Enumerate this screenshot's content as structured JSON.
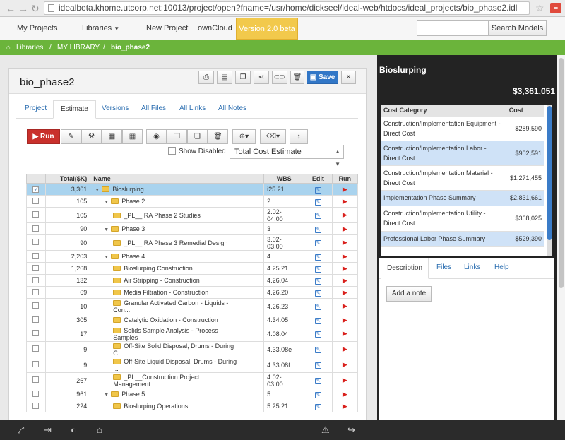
{
  "browser": {
    "url": "idealbeta.khome.utcorp.net:10013/project/open?fname=/usr/home/dickseel/ideal-web/htdocs/ideal_projects/bio_phase2.idl"
  },
  "topnav": {
    "my_projects": "My Projects",
    "libraries": "Libraries",
    "new_project": "New Project",
    "owncloud": "ownCloud",
    "version": "Version 2.0 beta",
    "search_placeholder": "",
    "search_button": "Search Models"
  },
  "breadcrumb": {
    "libraries": "Libraries",
    "my_library": "MY LIBRARY",
    "current": "bio_phase2"
  },
  "panel": {
    "title": "bio_phase2",
    "save": "Save",
    "close": "×",
    "tabs": [
      "Project",
      "Estimate",
      "Versions",
      "All Files",
      "All Links",
      "All Notes"
    ],
    "run": "Run",
    "show_disabled": "Show Disabled",
    "estimate_select": "Total Cost Estimate"
  },
  "grid": {
    "headers": [
      "",
      "Total($K)",
      "Name",
      "WBS",
      "Edit",
      "Run"
    ],
    "rows": [
      {
        "total": "3,361",
        "name": "Bioslurping",
        "wbs": "i25.21"
      },
      {
        "total": "105",
        "name": "Phase 2",
        "wbs": "2"
      },
      {
        "total": "105",
        "name": "_PL__IRA Phase 2 Studies",
        "wbs": "2.02-\n04.00"
      },
      {
        "total": "90",
        "name": "Phase 3",
        "wbs": "3"
      },
      {
        "total": "90",
        "name": "_PL__IRA Phase 3 Remedial Design",
        "wbs": "3.02-\n03.00"
      },
      {
        "total": "2,203",
        "name": "Phase 4",
        "wbs": "4"
      },
      {
        "total": "1,268",
        "name": "Bioslurping Construction",
        "wbs": "4.25.21"
      },
      {
        "total": "132",
        "name": "Air Stripping - Construction",
        "wbs": "4.26.04"
      },
      {
        "total": "69",
        "name": "Media Filtration - Construction",
        "wbs": "4.26.20"
      },
      {
        "total": "10",
        "name": "Granular Activated Carbon - Liquids -\nCon...",
        "wbs": "4.26.23"
      },
      {
        "total": "305",
        "name": "Catalytic Oxidation - Construction",
        "wbs": "4.34.05"
      },
      {
        "total": "17",
        "name": "Solids Sample Analysis - Process\nSamples",
        "wbs": "4.08.04"
      },
      {
        "total": "9",
        "name": "Off-Site Solid Disposal, Drums - During\nC...",
        "wbs": "4.33.08e"
      },
      {
        "total": "9",
        "name": "Off-Site Liquid Disposal, Drums - During\n...",
        "wbs": "4.33.08f"
      },
      {
        "total": "267",
        "name": "_PL__Construction Project\nManagement",
        "wbs": "4.02-\n03.00"
      },
      {
        "total": "961",
        "name": "Phase 5",
        "wbs": "5"
      },
      {
        "total": "224",
        "name": "Bioslurping Operations",
        "wbs": "5.25.21"
      }
    ]
  },
  "right": {
    "title": "Bioslurping",
    "total": "$3,361,051",
    "cost_headers": [
      "Cost Category",
      "Cost"
    ],
    "costs": [
      {
        "cat": "Construction/Implementation Equipment -\nDirect Cost",
        "val": "$289,590"
      },
      {
        "cat": "Construction/Implementation Labor -\nDirect Cost",
        "val": "$902,591"
      },
      {
        "cat": "Construction/Implementation Material -\nDirect Cost",
        "val": "$1,271,455"
      },
      {
        "cat": "Implementation Phase Summary",
        "val": "$2,831,661"
      },
      {
        "cat": "Construction/Implementation Utility -\nDirect Cost",
        "val": "$368,025"
      },
      {
        "cat": "Professional Labor Phase Summary",
        "val": "$529,390"
      }
    ],
    "tabs": [
      "Description",
      "Files",
      "Links",
      "Help"
    ],
    "add_note": "Add a note"
  }
}
